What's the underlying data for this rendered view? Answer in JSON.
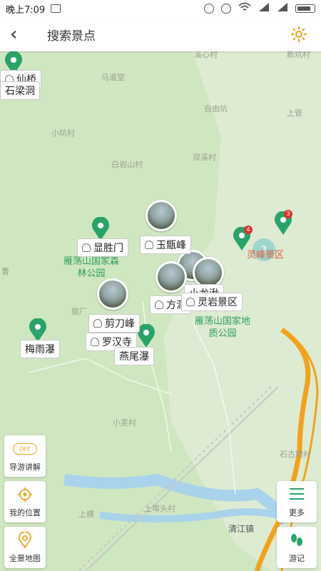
{
  "status": {
    "time": "晚上7:09"
  },
  "header": {
    "back_glyph": "‹",
    "search_text": "搜索景点"
  },
  "map": {
    "villages": [
      "溪心村",
      "新坑村",
      "马道堂",
      "自由坑",
      "上管",
      "小坑村",
      "白岩山村",
      "双溪村",
      "曹",
      "旋厂",
      "小芙村",
      "上埠头村",
      "上横",
      "石古墩村",
      "清江镇"
    ],
    "green_areas": [
      "雁荡山国家森林公园",
      "雁荡山国家地质公园"
    ],
    "scenic_area": "灵峰景区",
    "spots": [
      "仙桥",
      "石梁洞",
      "显胜门",
      "玉甑峰",
      "小龙湫",
      "方洞",
      "灵岩景区",
      "剪刀峰",
      "罗汉寺",
      "燕尾瀑",
      "梅雨瀑"
    ],
    "counts": [
      "4",
      "3"
    ],
    "unknown_glyph": "?"
  },
  "controls": {
    "guide": {
      "label": "导游讲解",
      "toggle": "OFF"
    },
    "locate": {
      "label": "我的位置"
    },
    "overview": {
      "label": "全景地图"
    },
    "more": {
      "label": "更多"
    },
    "notes": {
      "label": "游记"
    }
  },
  "colors": {
    "accent": "#2aa36a",
    "map_bg": "#cfe7c1",
    "road": "#f2a31b",
    "water": "#a9d3ea"
  }
}
